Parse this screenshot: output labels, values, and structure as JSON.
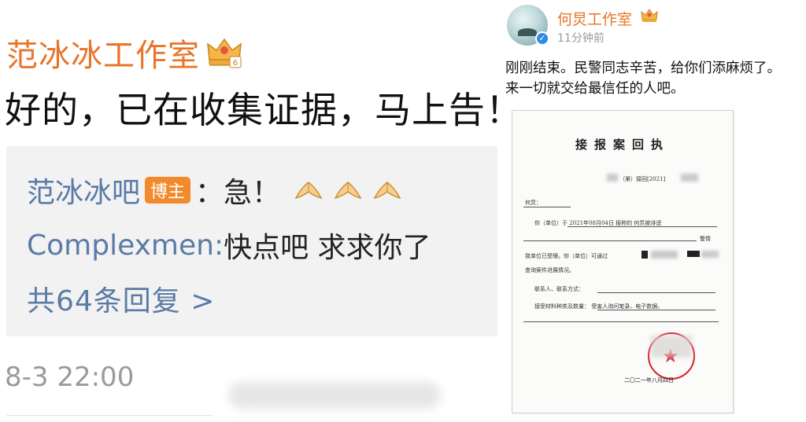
{
  "left": {
    "author": "范冰冰工作室",
    "reply_text": "好的，已在收集证据，马上告！！",
    "sub_replies": [
      {
        "user": "范冰冰吧",
        "badge": "博主",
        "text": "：急！"
      },
      {
        "user": "Complexmen:",
        "text": " 快点吧 求求你了"
      }
    ],
    "more_replies": "共64条回复 >",
    "timestamp": "8-3 22:00"
  },
  "right": {
    "author": "何炅工作室",
    "time": "11分钟前",
    "text_line1": "刚刚结束。民警同志辛苦，给你们添麻烦了。",
    "text_line2": "来一切就交给最信任的人吧。",
    "document": {
      "title": "接报案回执",
      "case_no": "（第）接回[2021]",
      "to_label": "何炅：",
      "line1": "你（单位）于  2021年08月04日  报称的  何炅被诽谤",
      "line1_suffix": "警情",
      "line2": "我单位已受理。你（单位）可通过",
      "line3": "查询案件进展情况。",
      "line4": "联系人、联系方式：",
      "line5": "接受材料种类及数量：  受害人询问笔录、电子数据。",
      "date": "二〇二一年八月四日"
    }
  },
  "colors": {
    "author_orange": "#e8752a",
    "link_blue": "#5a7ba6",
    "badge_orange": "#f28a2c",
    "seal_red": "#d8222a"
  },
  "icons": [
    "crown-icon",
    "pray-hands-icon",
    "verified-icon",
    "police-seal-icon"
  ]
}
